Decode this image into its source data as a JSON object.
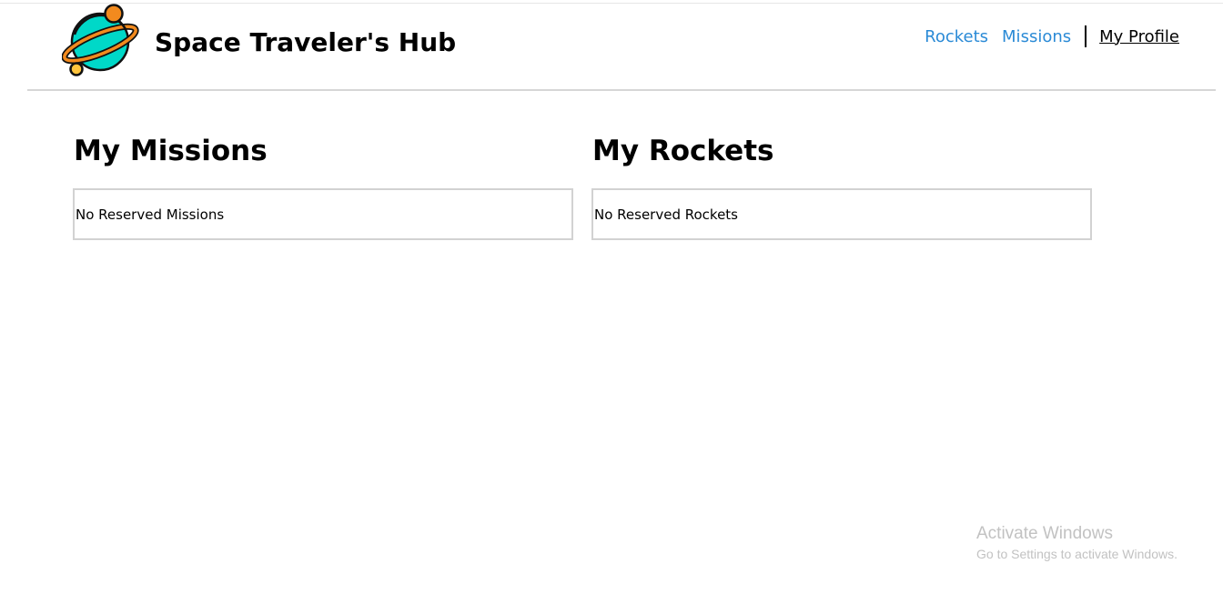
{
  "header": {
    "brand": "Space Traveler's Hub",
    "logo_icon": "planet-logo-icon",
    "nav": {
      "rockets": "Rockets",
      "missions": "Missions",
      "profile": "My Profile"
    }
  },
  "main": {
    "missions": {
      "title": "My Missions",
      "empty": "No Reserved Missions"
    },
    "rockets": {
      "title": "My Rockets",
      "empty": "No Reserved Rockets"
    }
  },
  "watermark": {
    "title": "Activate Windows",
    "subtitle": "Go to Settings to activate Windows."
  },
  "colors": {
    "nav_link": "#2a8ad6",
    "planet": "#00d8c8",
    "planet_ring": "#f28a1e",
    "moon": "#ffc43d"
  }
}
